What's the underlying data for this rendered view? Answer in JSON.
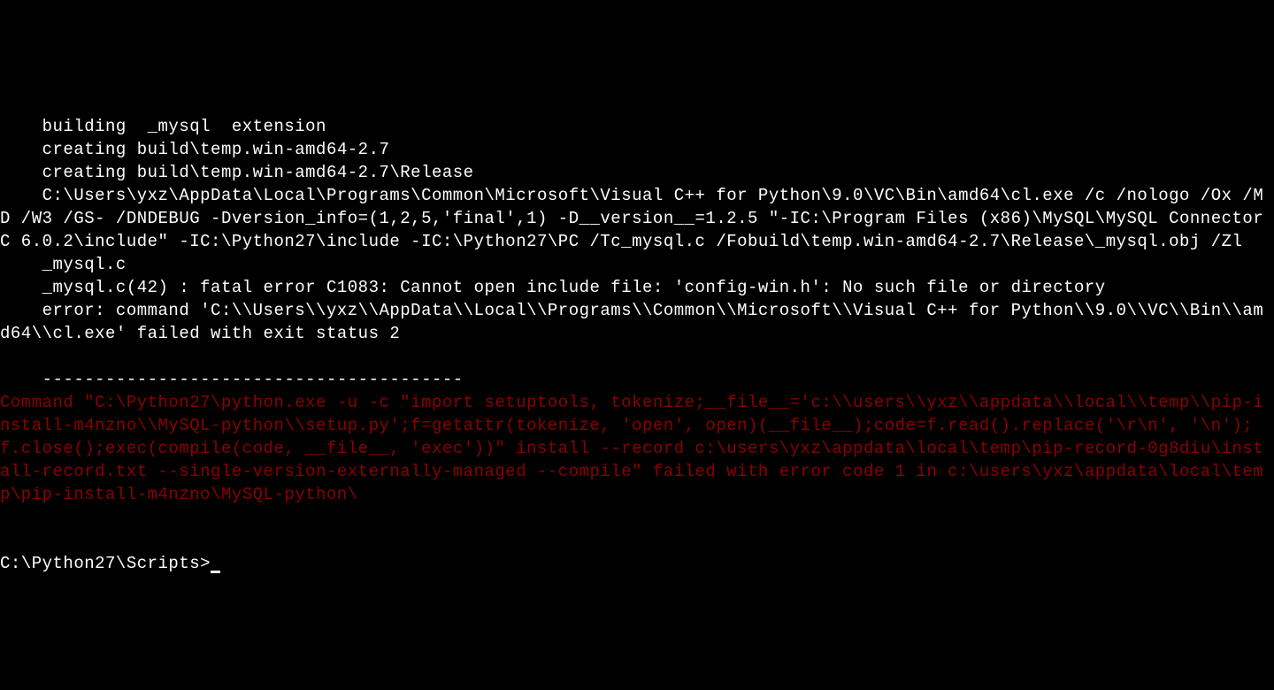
{
  "terminal": {
    "output_white": "    building  _mysql  extension\n    creating build\\temp.win-amd64-2.7\n    creating build\\temp.win-amd64-2.7\\Release\n    C:\\Users\\yxz\\AppData\\Local\\Programs\\Common\\Microsoft\\Visual C++ for Python\\9.0\\VC\\Bin\\amd64\\cl.exe /c /nologo /Ox /MD /W3 /GS- /DNDEBUG -Dversion_info=(1,2,5,'final',1) -D__version__=1.2.5 \"-IC:\\Program Files (x86)\\MySQL\\MySQL Connector C 6.0.2\\include\" -IC:\\Python27\\include -IC:\\Python27\\PC /Tc_mysql.c /Fobuild\\temp.win-amd64-2.7\\Release\\_mysql.obj /Zl\n    _mysql.c\n    _mysql.c(42) : fatal error C1083: Cannot open include file: 'config-win.h': No such file or directory\n    error: command 'C:\\\\Users\\\\yxz\\\\AppData\\\\Local\\\\Programs\\\\Common\\\\Microsoft\\\\Visual C++ for Python\\\\9.0\\\\VC\\\\Bin\\\\amd64\\\\cl.exe' failed with exit status 2\n\n    ----------------------------------------",
    "output_red": "Command \"C:\\Python27\\python.exe -u -c \"import setuptools, tokenize;__file__='c:\\\\users\\\\yxz\\\\appdata\\\\local\\\\temp\\\\pip-install-m4nzno\\\\MySQL-python\\\\setup.py';f=getattr(tokenize, 'open', open)(__file__);code=f.read().replace('\\r\\n', '\\n');f.close();exec(compile(code, __file__, 'exec'))\" install --record c:\\users\\yxz\\appdata\\local\\temp\\pip-record-0g8diu\\install-record.txt --single-version-externally-managed --compile\" failed with error code 1 in c:\\users\\yxz\\appdata\\local\\temp\\pip-install-m4nzno\\MySQL-python\\",
    "prompt": "C:\\Python27\\Scripts>"
  }
}
